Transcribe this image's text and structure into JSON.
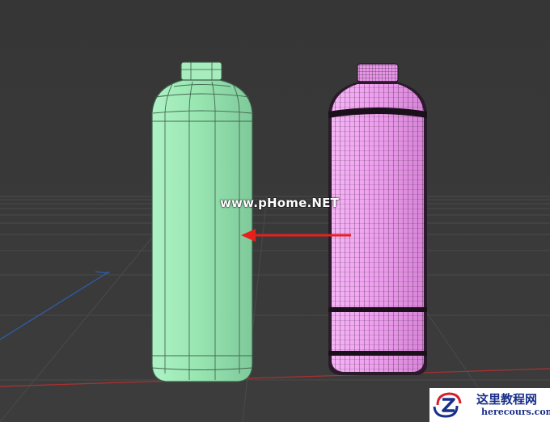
{
  "viewport": {
    "watermark": "www.pHome.NET"
  },
  "objects": [
    {
      "name": "low-poly-bottle",
      "color": "#9be8b4",
      "edge_color": "#3c5c48"
    },
    {
      "name": "high-poly-bottle",
      "color": "#f0a0f0",
      "edge_color": "#2a1a2a"
    }
  ],
  "annotation": {
    "arrow_color": "#e8201c"
  },
  "grid": {
    "floor_color": "#555555",
    "x_axis_color": "#b03030",
    "z_axis_color": "#2f5fb0"
  },
  "logo": {
    "title": "这里教程网",
    "subtitle": "herecours.com",
    "icon": "z-logo-icon",
    "brand_color": "#1a2f8a",
    "accent_color": "#d81e2a"
  }
}
